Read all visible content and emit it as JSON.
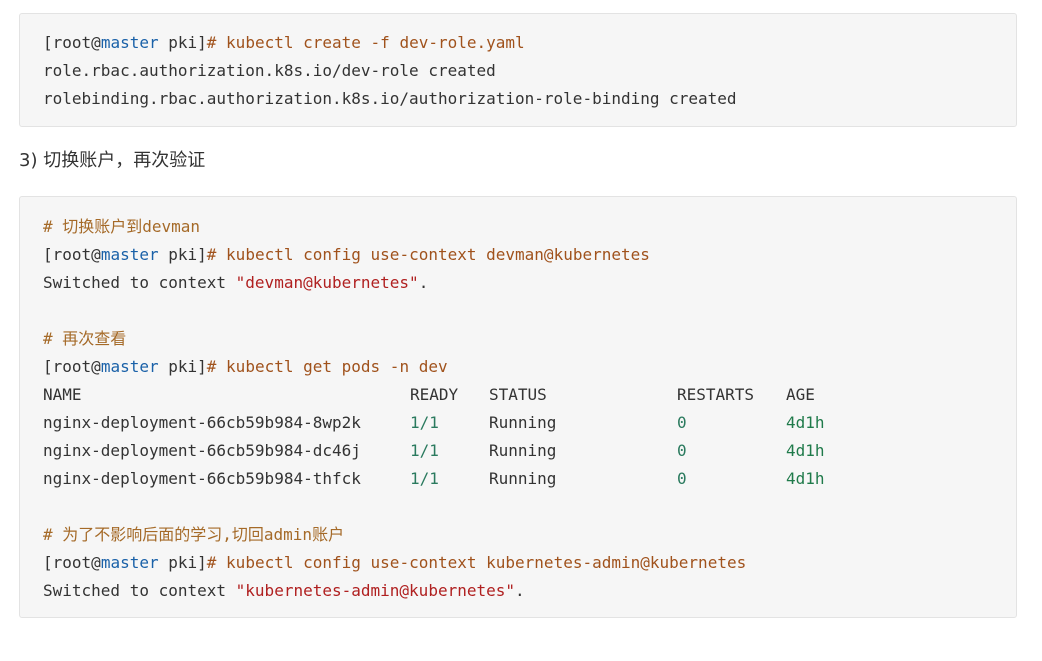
{
  "block1": {
    "prompt": {
      "open": "[root",
      "at": "@",
      "host": "master",
      "path": " pki]",
      "hash": "# "
    },
    "command": "kubectl create -f dev-role.yaml",
    "output": [
      "role.rbac.authorization.k8s.io/dev-role created",
      "rolebinding.rbac.authorization.k8s.io/authorization-role-binding created"
    ]
  },
  "heading": "3) 切换账户，再次验证",
  "block2": {
    "comment1": "# 切换账户到devman",
    "cmd1": "kubectl config use-context devman@kubernetes",
    "switch1": {
      "pre": "Switched to context ",
      "ctx": "\"devman@kubernetes\"",
      "post": "."
    },
    "comment2": "# 再次查看",
    "cmd2": "kubectl get pods -n dev",
    "table": {
      "headers": [
        "NAME",
        "READY",
        "STATUS",
        "RESTARTS",
        "AGE"
      ],
      "rows": [
        [
          "nginx-deployment-66cb59b984-8wp2k",
          "1/1",
          "Running",
          "0",
          "4d1h"
        ],
        [
          "nginx-deployment-66cb59b984-dc46j",
          "1/1",
          "Running",
          "0",
          "4d1h"
        ],
        [
          "nginx-deployment-66cb59b984-thfck",
          "1/1",
          "Running",
          "0",
          "4d1h"
        ]
      ]
    },
    "comment3": "# 为了不影响后面的学习,切回admin账户",
    "cmd3": "kubectl config use-context kubernetes-admin@kubernetes",
    "switch2": {
      "pre": "Switched to context ",
      "ctx": "\"kubernetes-admin@kubernetes\"",
      "post": "."
    }
  },
  "colors": {
    "host": "#1a61a8",
    "command": "#a0521c",
    "comment": "#a56a28",
    "string": "#b02020",
    "number": "#2a7a5e",
    "code_background": "#f6f6f6"
  }
}
